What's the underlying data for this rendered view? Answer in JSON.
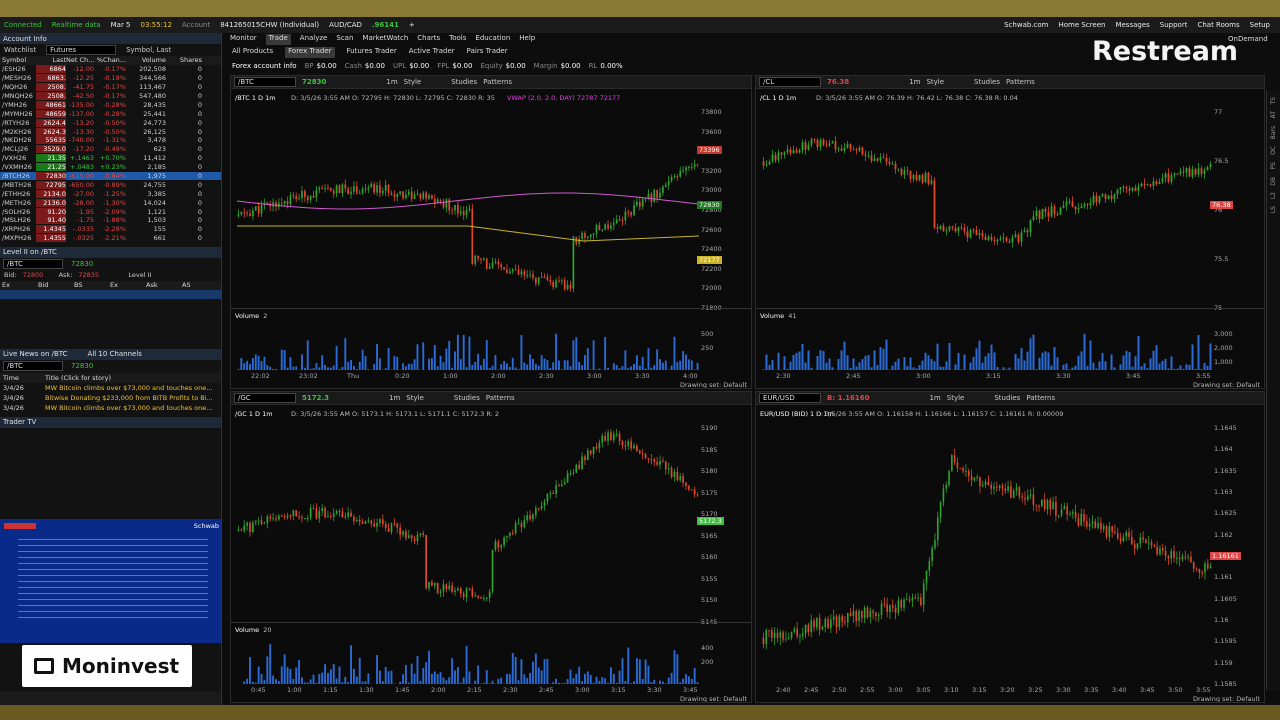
{
  "topbar": {
    "connected": "Connected",
    "realtime": "Realtime data",
    "date": "Mar 5",
    "time": "03:55:12",
    "account": "Account",
    "account_id": "841265015CHW (Individual)",
    "symbol": "AUD/CAD",
    "price": ".96141",
    "links": [
      "Schwab.com",
      "Home Screen",
      "Messages",
      "Support",
      "Chat Rooms",
      "Setup"
    ]
  },
  "tabs": [
    "Monitor",
    "Trade",
    "Analyze",
    "Scan",
    "MarketWatch",
    "Charts",
    "Tools",
    "Education",
    "Help"
  ],
  "subtabs": [
    "All Products",
    "Forex Trader",
    "Futures Trader",
    "Active Trader",
    "Pairs Trader"
  ],
  "ondemand": "OnDemand",
  "forex_bar": {
    "label": "Forex account info",
    "items": [
      [
        "BP",
        "$0.00"
      ],
      [
        "Cash",
        "$0.00"
      ],
      [
        "UPL",
        "$0.00"
      ],
      [
        "FPL",
        "$0.00"
      ],
      [
        "Equity",
        "$0.00"
      ],
      [
        "Margin",
        "$0.00"
      ],
      [
        "RL",
        "0.00%"
      ]
    ]
  },
  "left": {
    "account_info": "Account Info",
    "watchlist": "Watchlist",
    "futures": "Futures",
    "symbol_last": "Symbol, Last",
    "cols": [
      "Symbol",
      "Last",
      "Net Ch...",
      "%Chan...",
      "Volume",
      "Shares"
    ],
    "rows": [
      [
        "/ESH26",
        "6864",
        "-12.00",
        "-0.17%",
        "202,508",
        "0"
      ],
      [
        "/MESH26",
        "6863.",
        "-12.25",
        "-0.18%",
        "344,566",
        "0"
      ],
      [
        "/NQH26",
        "2508.",
        "-41.75",
        "-0.17%",
        "113,467",
        "0"
      ],
      [
        "/MNQH26",
        "2508.",
        "-42.50",
        "-0.17%",
        "547,480",
        "0"
      ],
      [
        "/YMH26",
        "48661",
        "-135.00",
        "-0.28%",
        "28,435",
        "0"
      ],
      [
        "/MYMH26",
        "48659",
        "-137.00",
        "-0.28%",
        "25,441",
        "0"
      ],
      [
        "/RTYH26",
        "2624.4",
        "-13.20",
        "-0.50%",
        "24,773",
        "0"
      ],
      [
        "/M2KH26",
        "2624.3",
        "-13.30",
        "-0.50%",
        "26,125",
        "0"
      ],
      [
        "/NKDH26",
        "55635",
        "-740.00",
        "-1.31%",
        "3,478",
        "0"
      ],
      [
        "/MCLJ26",
        "3529.0",
        "-17.20",
        "-0.49%",
        "623",
        "0"
      ],
      [
        "/VXH26",
        "21.35",
        "+.1463",
        "+0.70%",
        "11,412",
        "0"
      ],
      [
        "/VXMH26",
        "21.25",
        "+.0483",
        "+0.23%",
        "2,185",
        "0"
      ],
      [
        "/BTCH26",
        "72830",
        "-615.00",
        "-0.84%",
        "1,975",
        "0"
      ],
      [
        "/MBTH26",
        "72795",
        "-650.00",
        "-0.89%",
        "24,755",
        "0"
      ],
      [
        "/ETHH26",
        "2134.0",
        "-27.00",
        "-1.25%",
        "3,385",
        "0"
      ],
      [
        "/METH26",
        "2136.0",
        "-28.00",
        "-1.30%",
        "14,024",
        "0"
      ],
      [
        "/SOLH26",
        "91.20",
        "-1.95",
        "-2.09%",
        "1,121",
        "0"
      ],
      [
        "/MSLH26",
        "91.40",
        "-1.75",
        "-1.88%",
        "1,503",
        "0"
      ],
      [
        "/XRPH26",
        "1.4345",
        "-.0335",
        "-2.28%",
        "155",
        "0"
      ],
      [
        "/MXPH26",
        "1.4355",
        "-.0325",
        "-2.21%",
        "661",
        "0"
      ]
    ],
    "level2": "Level II on /BTC",
    "l2_sym": "/BTC",
    "l2_price": "72830",
    "bid": "Bid:",
    "ask": "Ask:",
    "level": "Level II",
    "l2_cols": [
      "Ex",
      "Bid",
      "BS",
      "Ex",
      "Ask",
      "AS"
    ],
    "news_title": "Live News on /BTC",
    "news_channels": "All 10 Channels",
    "news_sym": "/BTC",
    "news_price": "72830",
    "news_cols": [
      "Time",
      "Title (Click for story)"
    ],
    "news": [
      [
        "3/4/26",
        "MW Bitcoin climbs over $73,000 and touches one..."
      ],
      [
        "3/4/26",
        "Bitwise Donating $233,000 from BITB Profits to Bi..."
      ],
      [
        "3/4/26",
        "MW Bitcoin climbs over $73,000 and touches one..."
      ]
    ],
    "trader_tv": "Trader TV",
    "tv_brand": "Schwab"
  },
  "logos": {
    "restream": "Restream",
    "moninvest": "Moninvest"
  },
  "charts": [
    {
      "sym": "/BTC",
      "price": "72830",
      "title": "/BTC 1 D 1m",
      "ohlc": "D: 3/5/26 3:55 AM  O: 72795  H: 72830  L: 72795  C: 72830  R: 35",
      "study": "VWAP (2.0, 2.0, DAY)  72787  72177",
      "vol_label": "Volume",
      "vol": "2",
      "aggr": "1m",
      "style": "Style",
      "studies": "Studies",
      "patterns": "Patterns",
      "drawing": "Drawing set: Default",
      "yticks": [
        "73800",
        "73600",
        "73400",
        "73200",
        "73000",
        "72800",
        "72600",
        "72400",
        "72200",
        "72000",
        "71800"
      ],
      "vticks": [
        "500",
        "250"
      ],
      "xticks": [
        "22:02",
        "23:02",
        "Thu",
        "0:20",
        "1:00",
        "2:00",
        "2:30",
        "3:00",
        "3:30",
        "4:00"
      ],
      "tags": [
        "73396",
        "72830",
        "72177"
      ],
      "accent": "#3ec23e"
    },
    {
      "sym": "/CL",
      "price": "76.38",
      "title": "/CL 1 D 1m",
      "ohlc": "D: 3/5/26 3:55 AM  O: 76.39  H: 76.42  L: 76.38  C: 76.38  R: 0.04",
      "study": "",
      "vol_label": "Volume",
      "vol": "41",
      "aggr": "1m",
      "style": "Style",
      "studies": "Studies",
      "patterns": "Patterns",
      "drawing": "Drawing set: Default",
      "yticks": [
        "77",
        "76.5",
        "76",
        "75.5",
        "75"
      ],
      "vticks": [
        "3,000",
        "2,000",
        "1,000"
      ],
      "xticks": [
        "2:30",
        "2:45",
        "3:00",
        "3:15",
        "3:30",
        "3:45",
        "3:55"
      ],
      "tags": [
        "76.38"
      ],
      "accent": "#e04646"
    },
    {
      "sym": "/GC",
      "price": "5172.3",
      "title": "/GC 1 D 1m",
      "ohlc": "D: 3/5/26 3:55 AM  O: 5173.1  H: 5173.1  L: 5171.1  C: 5172.3  R: 2",
      "study": "",
      "vol_label": "Volume",
      "vol": "20",
      "aggr": "1m",
      "style": "Style",
      "studies": "Studies",
      "patterns": "Patterns",
      "drawing": "Drawing set: Default",
      "yticks": [
        "5190",
        "5185",
        "5180",
        "5175",
        "5170",
        "5165",
        "5160",
        "5155",
        "5150",
        "5145"
      ],
      "vticks": [
        "400",
        "200"
      ],
      "xticks": [
        "0:45",
        "1:00",
        "1:15",
        "1:30",
        "1:45",
        "2:00",
        "2:15",
        "2:30",
        "2:45",
        "3:00",
        "3:15",
        "3:30",
        "3:45"
      ],
      "tags": [
        "5172.3"
      ],
      "accent": "#3ec23e"
    },
    {
      "sym": "EUR/USD",
      "price": "B: 1.16160",
      "title": "EUR/USD (BID) 1 D 1m",
      "ohlc": "D: 3/5/26 3:55 AM  O: 1.16158  H: 1.16166  L: 1.16157  C: 1.16161  R: 0.00009",
      "study": "",
      "vol_label": "",
      "vol": "",
      "aggr": "1m",
      "style": "Style",
      "studies": "Studies",
      "patterns": "Patterns",
      "drawing": "Drawing set: Default",
      "yticks": [
        "1.1645",
        "1.164",
        "1.1635",
        "1.163",
        "1.1625",
        "1.162",
        "1.1615",
        "1.161",
        "1.1605",
        "1.16",
        "1.1595",
        "1.159",
        "1.1585"
      ],
      "vticks": [],
      "xticks": [
        "2:40",
        "2:45",
        "2:50",
        "2:55",
        "3:00",
        "3:05",
        "3:10",
        "3:15",
        "3:20",
        "3:25",
        "3:30",
        "3:35",
        "3:40",
        "3:45",
        "3:50",
        "3:55"
      ],
      "tags": [
        "1.16161"
      ],
      "accent": "#e04646"
    }
  ],
  "sidebar": [
    "TS",
    "AT",
    "Bars",
    "OC",
    "PS",
    "DB",
    "L2",
    "LS"
  ]
}
